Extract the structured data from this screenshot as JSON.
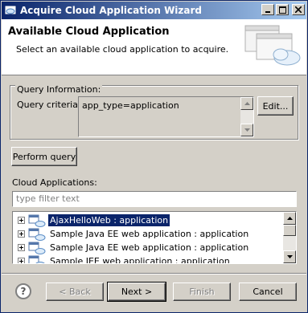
{
  "window": {
    "title": "Acquire Cloud Application Wizard",
    "controls": {
      "minimize": "_",
      "maximize": "□",
      "close": "X"
    }
  },
  "header": {
    "title": "Available Cloud Application",
    "description": "Select an available cloud application to acquire."
  },
  "query": {
    "group_label": "Query Information:",
    "criteria_label": "Query criteria:",
    "criteria_value": "app_type=application",
    "edit_button": "Edit...",
    "perform_button": "Perform query"
  },
  "apps": {
    "label": "Cloud Applications:",
    "filter_placeholder": "type filter text",
    "items": [
      {
        "label": "AjaxHelloWeb : application",
        "selected": true
      },
      {
        "label": "Sample Java EE web application : application",
        "selected": false
      },
      {
        "label": "Sample Java EE web application : application",
        "selected": false
      },
      {
        "label": "Sample JEE web application : application",
        "selected": false
      }
    ]
  },
  "footer": {
    "help": "?",
    "back": "< Back",
    "next": "Next >",
    "finish": "Finish",
    "cancel": "Cancel"
  },
  "colors": {
    "title_bar_start": "#0a246a",
    "title_bar_end": "#a6caf0",
    "selection": "#0a246a",
    "dialog_bg": "#d4d0c8"
  }
}
